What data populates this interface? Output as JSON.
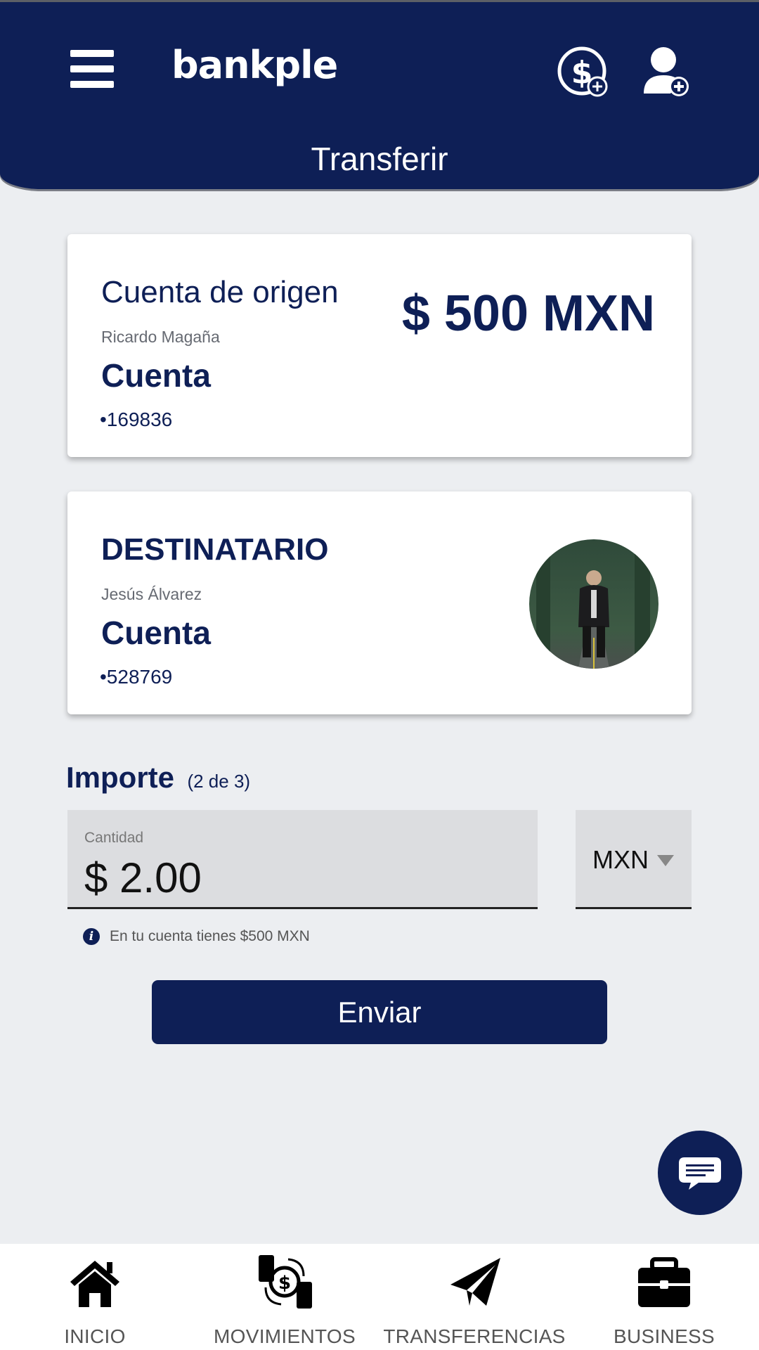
{
  "header": {
    "logo_text": "bankple",
    "page_title": "Transferir",
    "icons": {
      "menu": "hamburger-menu-icon",
      "add_money": "dollar-plus-icon",
      "add_user": "user-plus-icon"
    }
  },
  "origin_card": {
    "heading": "Cuenta de origen",
    "owner": "Ricardo Magaña",
    "account_label": "Cuenta",
    "account_number": "•169836",
    "balance": "$ 500 MXN"
  },
  "recipient_card": {
    "heading": "DESTINATARIO",
    "name": "Jesús Álvarez",
    "account_label": "Cuenta",
    "account_number": "•528769",
    "avatar": "recipient-photo"
  },
  "amount_section": {
    "title": "Importe",
    "step": "(2 de 3)",
    "amount_label": "Cantidad",
    "amount_value": "$ 2.00",
    "currency": "MXN",
    "info_text": "En tu cuenta tienes $500 MXN"
  },
  "actions": {
    "send_label": "Enviar"
  },
  "chat": {
    "icon": "chat-bubble-icon"
  },
  "bottom_nav": {
    "items": [
      {
        "label": "INICIO",
        "icon": "home-icon"
      },
      {
        "label": "MOVIMIENTOS",
        "icon": "money-exchange-icon"
      },
      {
        "label": "TRANSFERENCIAS",
        "icon": "paper-plane-icon"
      },
      {
        "label": "BUSINESS",
        "icon": "briefcase-icon"
      }
    ]
  },
  "colors": {
    "primary": "#0e1f56",
    "background": "#eceef1",
    "field": "#dcdde0"
  }
}
